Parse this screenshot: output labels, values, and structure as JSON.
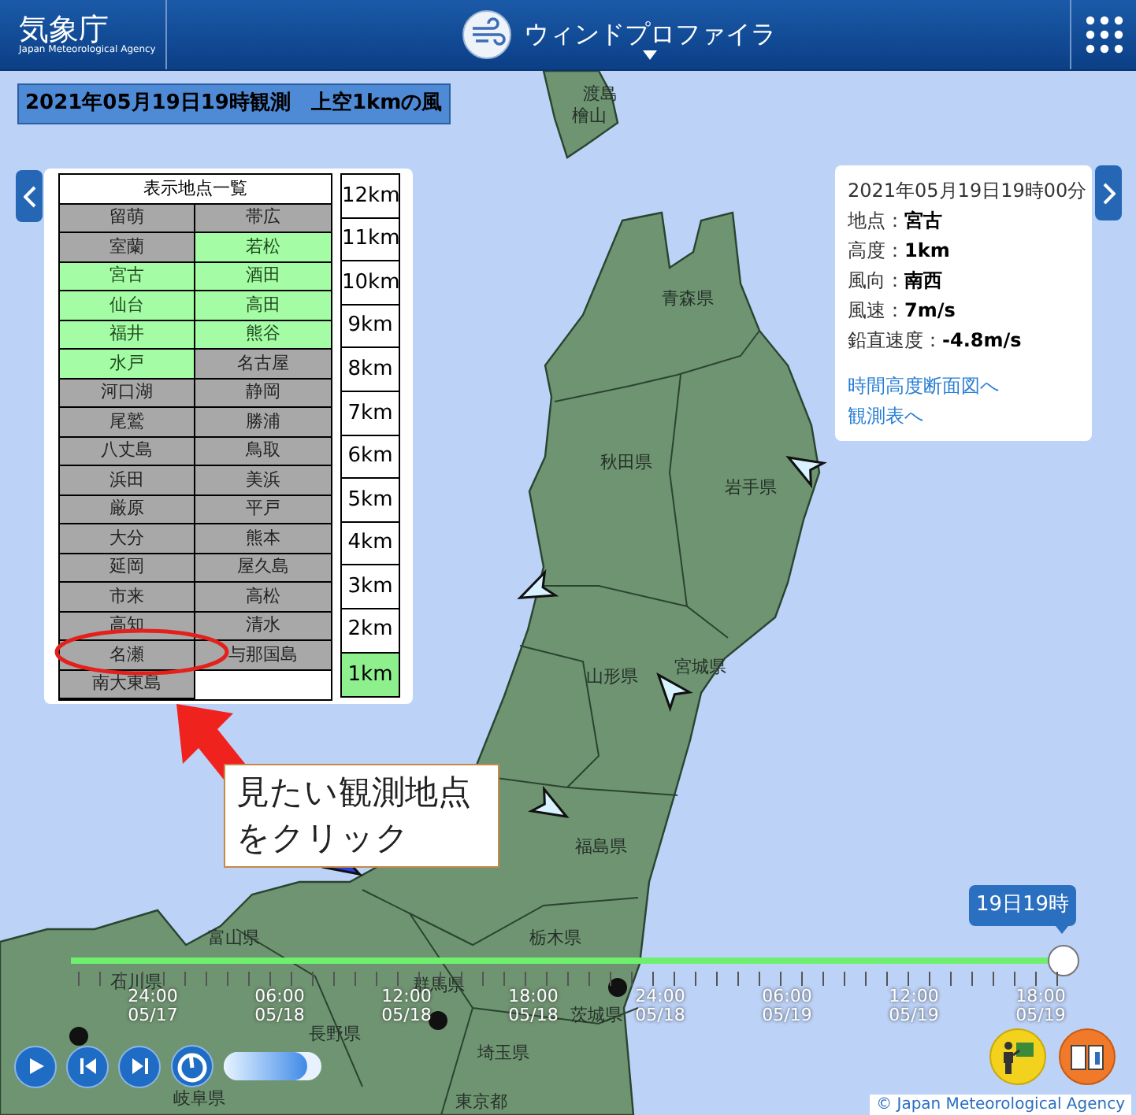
{
  "header": {
    "logo_text": "気象庁",
    "logo_subtitle": "Japan Meteorological Agency",
    "title": "ウィンドプロファイラ"
  },
  "observation_title": "2021年05月19日19時観測　上空1kmの風",
  "station_list": {
    "heading": "表示地点一覧",
    "stations": [
      {
        "name": "留萌",
        "active": false
      },
      {
        "name": "帯広",
        "active": false
      },
      {
        "name": "室蘭",
        "active": false
      },
      {
        "name": "若松",
        "active": true
      },
      {
        "name": "宮古",
        "active": true
      },
      {
        "name": "酒田",
        "active": true
      },
      {
        "name": "仙台",
        "active": true
      },
      {
        "name": "高田",
        "active": true
      },
      {
        "name": "福井",
        "active": true
      },
      {
        "name": "熊谷",
        "active": true
      },
      {
        "name": "水戸",
        "active": true
      },
      {
        "name": "名古屋",
        "active": false
      },
      {
        "name": "河口湖",
        "active": false
      },
      {
        "name": "静岡",
        "active": false
      },
      {
        "name": "尾鷲",
        "active": false
      },
      {
        "name": "勝浦",
        "active": false
      },
      {
        "name": "八丈島",
        "active": false
      },
      {
        "name": "鳥取",
        "active": false
      },
      {
        "name": "浜田",
        "active": false
      },
      {
        "name": "美浜",
        "active": false
      },
      {
        "name": "厳原",
        "active": false
      },
      {
        "name": "平戸",
        "active": false
      },
      {
        "name": "大分",
        "active": false
      },
      {
        "name": "熊本",
        "active": false
      },
      {
        "name": "延岡",
        "active": false
      },
      {
        "name": "屋久島",
        "active": false
      },
      {
        "name": "市来",
        "active": false
      },
      {
        "name": "高松",
        "active": false
      },
      {
        "name": "高知",
        "active": false
      },
      {
        "name": "清水",
        "active": false
      },
      {
        "name": "名瀬",
        "active": false
      },
      {
        "name": "与那国島",
        "active": false
      },
      {
        "name": "南大東島",
        "active": false
      }
    ]
  },
  "altitudes": [
    {
      "label": "12km",
      "selected": false
    },
    {
      "label": "11km",
      "selected": false
    },
    {
      "label": "10km",
      "selected": false
    },
    {
      "label": "9km",
      "selected": false
    },
    {
      "label": "8km",
      "selected": false
    },
    {
      "label": "7km",
      "selected": false
    },
    {
      "label": "6km",
      "selected": false
    },
    {
      "label": "5km",
      "selected": false
    },
    {
      "label": "4km",
      "selected": false
    },
    {
      "label": "3km",
      "selected": false
    },
    {
      "label": "2km",
      "selected": false
    },
    {
      "label": "1km",
      "selected": true
    }
  ],
  "info": {
    "datetime": "2021年05月19日19時00分",
    "fields": [
      {
        "label": "地点：",
        "value": "宮古"
      },
      {
        "label": "高度：",
        "value": "1km"
      },
      {
        "label": "風向：",
        "value": "南西"
      },
      {
        "label": "風速：",
        "value": "7m/s"
      },
      {
        "label": "鉛直速度：",
        "value": "-4.8m/s"
      }
    ],
    "links": [
      "時間高度断面図へ",
      "観測表へ"
    ]
  },
  "map": {
    "labels": [
      "渡島",
      "檜山",
      "青森県",
      "秋田県",
      "岩手県",
      "山形県",
      "宮城県",
      "福島県",
      "富山県",
      "石川県",
      "群馬県",
      "栃木県",
      "茨城県",
      "長野県",
      "埼玉県",
      "岐阜県",
      "東京都"
    ]
  },
  "callout": "見たい観測地点をクリック",
  "timeline": {
    "tooltip": "19日19時",
    "level": 1,
    "labels": [
      {
        "time": "24:00",
        "date": "05/17"
      },
      {
        "time": "06:00",
        "date": "05/18"
      },
      {
        "time": "12:00",
        "date": "05/18"
      },
      {
        "time": "18:00",
        "date": "05/18"
      },
      {
        "time": "24:00",
        "date": "05/18"
      },
      {
        "time": "06:00",
        "date": "05/19"
      },
      {
        "time": "12:00",
        "date": "05/19"
      },
      {
        "time": "18:00",
        "date": "05/19"
      }
    ]
  },
  "speed": {
    "level": 0.85
  },
  "copyright": "© Japan Meteorological Agency"
}
